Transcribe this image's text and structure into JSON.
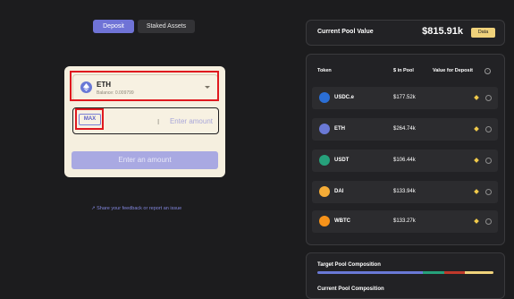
{
  "tabs": {
    "deposit": "Deposit",
    "staked": "Staked Assets"
  },
  "deposit_card": {
    "token": {
      "symbol": "ETH",
      "balance": "Balance: 0.009799",
      "icon": "eth-icon"
    },
    "max_label": "MAX",
    "amount_placeholder": "Enter amount",
    "submit_label": "Enter an amount"
  },
  "feedback_link": "↗ Share your feedback or report an issue",
  "pool_value": {
    "label": "Current Pool Value",
    "amount": "$815.91k",
    "badge": "Data"
  },
  "table": {
    "headers": {
      "token": "Token",
      "in_pool": "$ in Pool",
      "value_for_deposit": "Value for Deposit"
    },
    "rows": [
      {
        "token": "USDC.e",
        "in_pool": "$177.52k",
        "icon": "usdc-icon",
        "color": "#2b6fd6"
      },
      {
        "token": "ETH",
        "in_pool": "$264.74k",
        "icon": "eth-icon",
        "color": "#6a79d6"
      },
      {
        "token": "USDT",
        "in_pool": "$106.44k",
        "icon": "usdt-icon",
        "color": "#26a17b"
      },
      {
        "token": "DAI",
        "in_pool": "$133.94k",
        "icon": "dai-icon",
        "color": "#f5ac37"
      },
      {
        "token": "WBTC",
        "in_pool": "$133.27k",
        "icon": "wbtc-icon",
        "color": "#f7931a"
      }
    ]
  },
  "target_composition": {
    "title": "Target Pool Composition",
    "next_title": "Current Pool Composition",
    "segments": [
      {
        "color": "#6a79d6",
        "share": 0.6
      },
      {
        "color": "#26a17b",
        "share": 0.12
      },
      {
        "color": "#c0392b",
        "share": 0.12
      },
      {
        "color": "#f0d27b",
        "share": 0.16
      }
    ]
  },
  "colors": {
    "accent": "#6f73d6",
    "highlight": "#e0191f",
    "badge": "#f0d27b"
  }
}
